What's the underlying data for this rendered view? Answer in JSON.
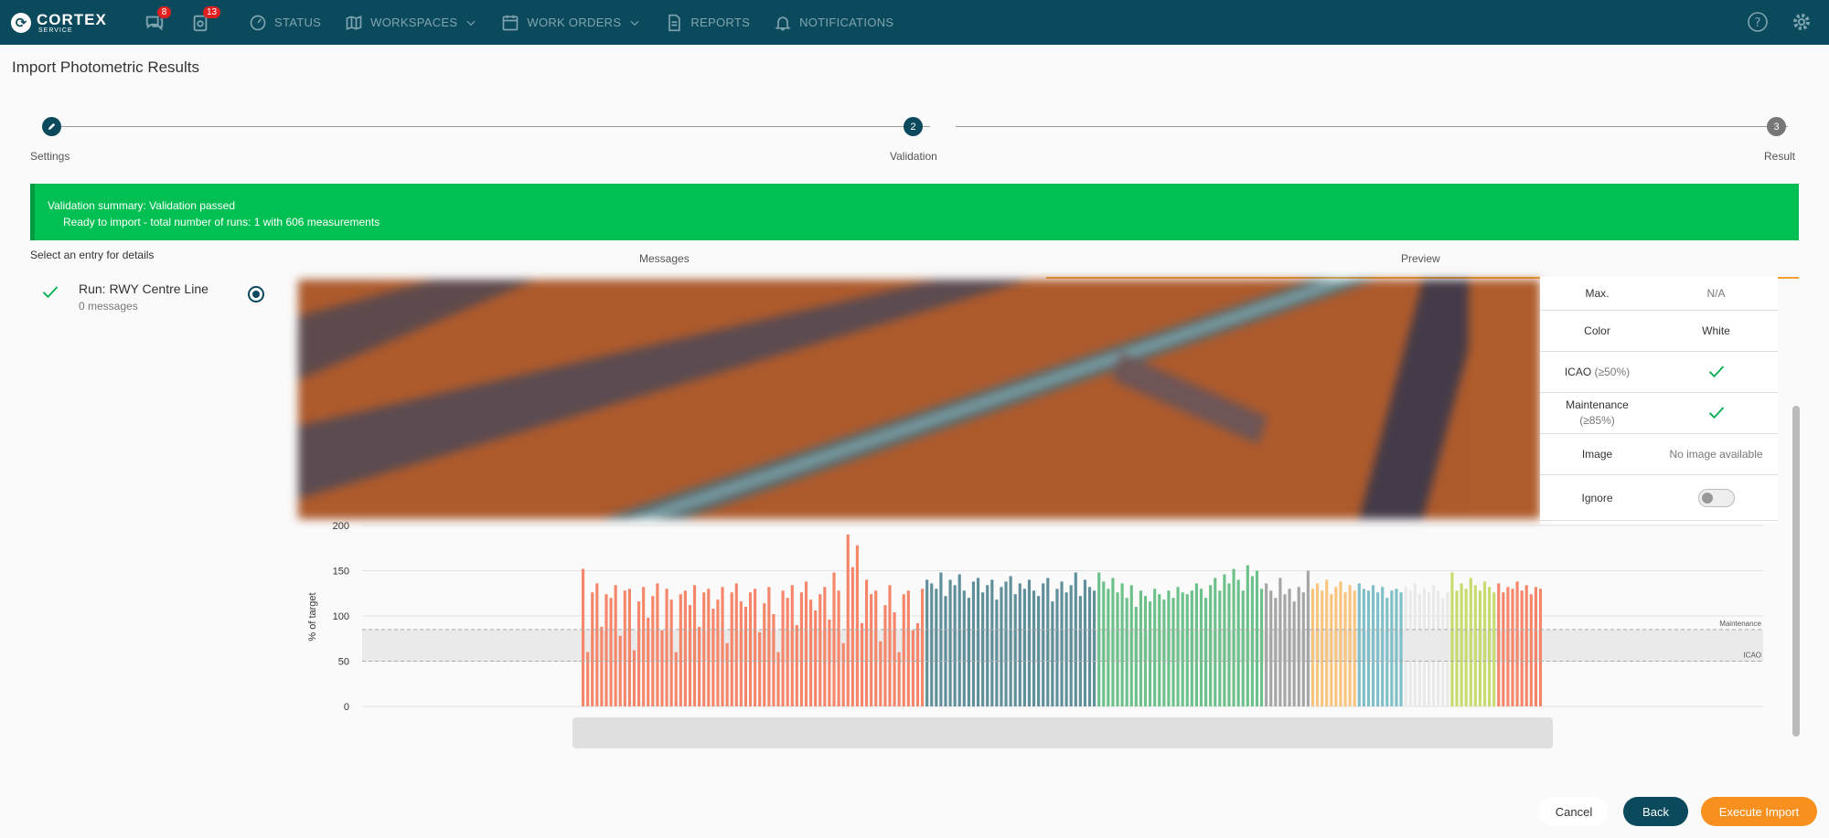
{
  "app": {
    "brand": "CORTEX",
    "brand_sub": "SERVICE",
    "messages_badge": "8",
    "tasks_badge": "13"
  },
  "nav": {
    "status": "STATUS",
    "workspaces": "WORKSPACES",
    "work_orders": "WORK ORDERS",
    "reports": "REPORTS",
    "notifications": "NOTIFICATIONS"
  },
  "page": {
    "title": "Import Photometric Results"
  },
  "stepper": {
    "steps": [
      {
        "label": "Settings",
        "number": "",
        "state": "done"
      },
      {
        "label": "Validation",
        "number": "2",
        "state": "active"
      },
      {
        "label": "Result",
        "number": "3",
        "state": "pending"
      }
    ]
  },
  "summary": {
    "line1": "Validation summary:  Validation passed",
    "line2": "Ready to import - total number of runs: 1 with 606 measurements"
  },
  "entries": {
    "select_label": "Select an entry for details",
    "tab_messages": "Messages",
    "tab_preview": "Preview",
    "run_name": "Run: RWY Centre Line",
    "run_messages": "0 messages"
  },
  "details": {
    "max_label": "Max.",
    "max_value": "N/A",
    "color_label": "Color",
    "color_value": "White",
    "icao_label": "ICAO",
    "icao_threshold": "(≥50%)",
    "maintenance_label": "Maintenance",
    "maintenance_threshold": "(≥85%)",
    "image_label": "Image",
    "image_value": "No image available",
    "ignore_label": "Ignore",
    "ignore_on": false
  },
  "chart_data": {
    "type": "bar",
    "ylabel": "% of target",
    "ylim": [
      0,
      200
    ],
    "yticks": [
      0,
      50,
      100,
      150,
      200
    ],
    "thresholds": [
      {
        "name": "Maintenance",
        "value": 85
      },
      {
        "name": "ICAO",
        "value": 50
      }
    ],
    "groups": [
      {
        "color": "#f5866a",
        "count": 74,
        "values": [
          152,
          60,
          126,
          136,
          88,
          124,
          120,
          134,
          78,
          128,
          130,
          62,
          116,
          132,
          98,
          122,
          136,
          84,
          130,
          118,
          60,
          124,
          128,
          112,
          134,
          88,
          126,
          130,
          108,
          118,
          132,
          70,
          126,
          136,
          116,
          110,
          126,
          130,
          82,
          114,
          132,
          102,
          60,
          128,
          120,
          134,
          90,
          126,
          138,
          118,
          106,
          124,
          132,
          96,
          148,
          128,
          70,
          190,
          154,
          178,
          92,
          140,
          124,
          128,
          72,
          112,
          134,
          104,
          60,
          124,
          128,
          84,
          92,
          130
        ]
      },
      {
        "color": "#5f8f9a",
        "count": 37,
        "values": [
          140,
          136,
          130,
          148,
          122,
          140,
          134,
          146,
          128,
          120,
          138,
          142,
          126,
          134,
          140,
          118,
          132,
          138,
          144,
          124,
          136,
          130,
          140,
          128,
          122,
          136,
          142,
          116,
          130,
          138,
          126,
          134,
          148,
          122,
          140,
          132,
          128
        ]
      },
      {
        "color": "#6cc18a",
        "count": 36,
        "values": [
          148,
          138,
          130,
          142,
          126,
          136,
          120,
          134,
          110,
          128,
          122,
          116,
          130,
          124,
          118,
          128,
          120,
          132,
          126,
          124,
          128,
          136,
          130,
          120,
          134,
          142,
          128,
          146,
          136,
          152,
          140,
          128,
          156,
          144,
          150,
          130
        ]
      },
      {
        "color": "#a5a5a5",
        "count": 10,
        "values": [
          136,
          128,
          120,
          142,
          124,
          130,
          116,
          132,
          126,
          150
        ]
      },
      {
        "color": "#f9c47e",
        "count": 10,
        "values": [
          130,
          136,
          128,
          140,
          124,
          132,
          138,
          126,
          134,
          128
        ]
      },
      {
        "color": "#7fbfc9",
        "count": 10,
        "values": [
          136,
          130,
          128,
          134,
          126,
          132,
          120,
          128,
          130,
          126
        ]
      },
      {
        "color": "#e9e9e9",
        "count": 10,
        "values": [
          132,
          128,
          136,
          124,
          130,
          126,
          134,
          128,
          120,
          126
        ]
      },
      {
        "color": "#c6dc6e",
        "count": 10,
        "values": [
          148,
          128,
          136,
          130,
          142,
          134,
          128,
          138,
          132,
          126
        ]
      },
      {
        "color": "#f5866a",
        "count": 10,
        "values": [
          136,
          126,
          132,
          130,
          138,
          128,
          134,
          124,
          132,
          130
        ]
      }
    ]
  },
  "footer": {
    "cancel": "Cancel",
    "back": "Back",
    "execute": "Execute Import"
  }
}
